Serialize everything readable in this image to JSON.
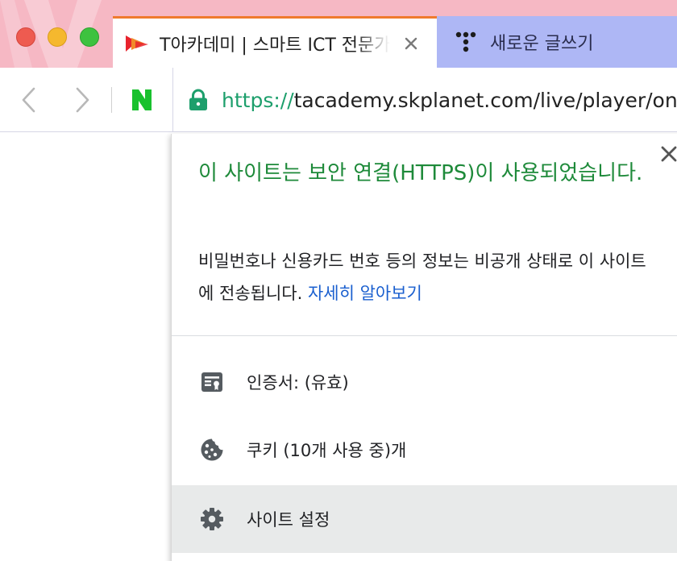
{
  "window": {
    "traffic_colors": {
      "close": "#ee5b50",
      "minimize": "#f5b82e",
      "maximize": "#3ec23f"
    }
  },
  "tabs": [
    {
      "title": "T아카데미 | 스마트 ICT 전문가",
      "favicon": "tacademy-favicon-icon",
      "active": true
    },
    {
      "title": "새로운 글쓰기",
      "favicon": "tistory-favicon-icon",
      "active": false
    }
  ],
  "toolbar": {
    "url_scheme": "https://",
    "url_rest": "tacademy.skplanet.com/live/player/onli",
    "bookmark": "naver-icon"
  },
  "popup": {
    "heading": "이 사이트는 보안 연결(HTTPS)이 사용되었습니다.",
    "description": "비밀번호나 신용카드 번호 등의 정보는 비공개 상태로 이 사이트에 전송됩니다. ",
    "learn_more": "자세히 알아보기",
    "rows": [
      {
        "label": "인증서: (유효)",
        "icon": "certificate-icon"
      },
      {
        "label": "쿠키 (10개 사용 중)개",
        "icon": "cookie-icon"
      },
      {
        "label": "사이트 설정",
        "icon": "gear-icon"
      }
    ]
  },
  "colors": {
    "secure_green": "#1e8a3a",
    "url_scheme_green": "#1d9f6c",
    "link_blue": "#1a5fcf",
    "active_tab_accent": "#ef7a2e",
    "inactive_tab_bg": "#aeb7f5",
    "tabstrip_bg": "#f6b8c4"
  }
}
